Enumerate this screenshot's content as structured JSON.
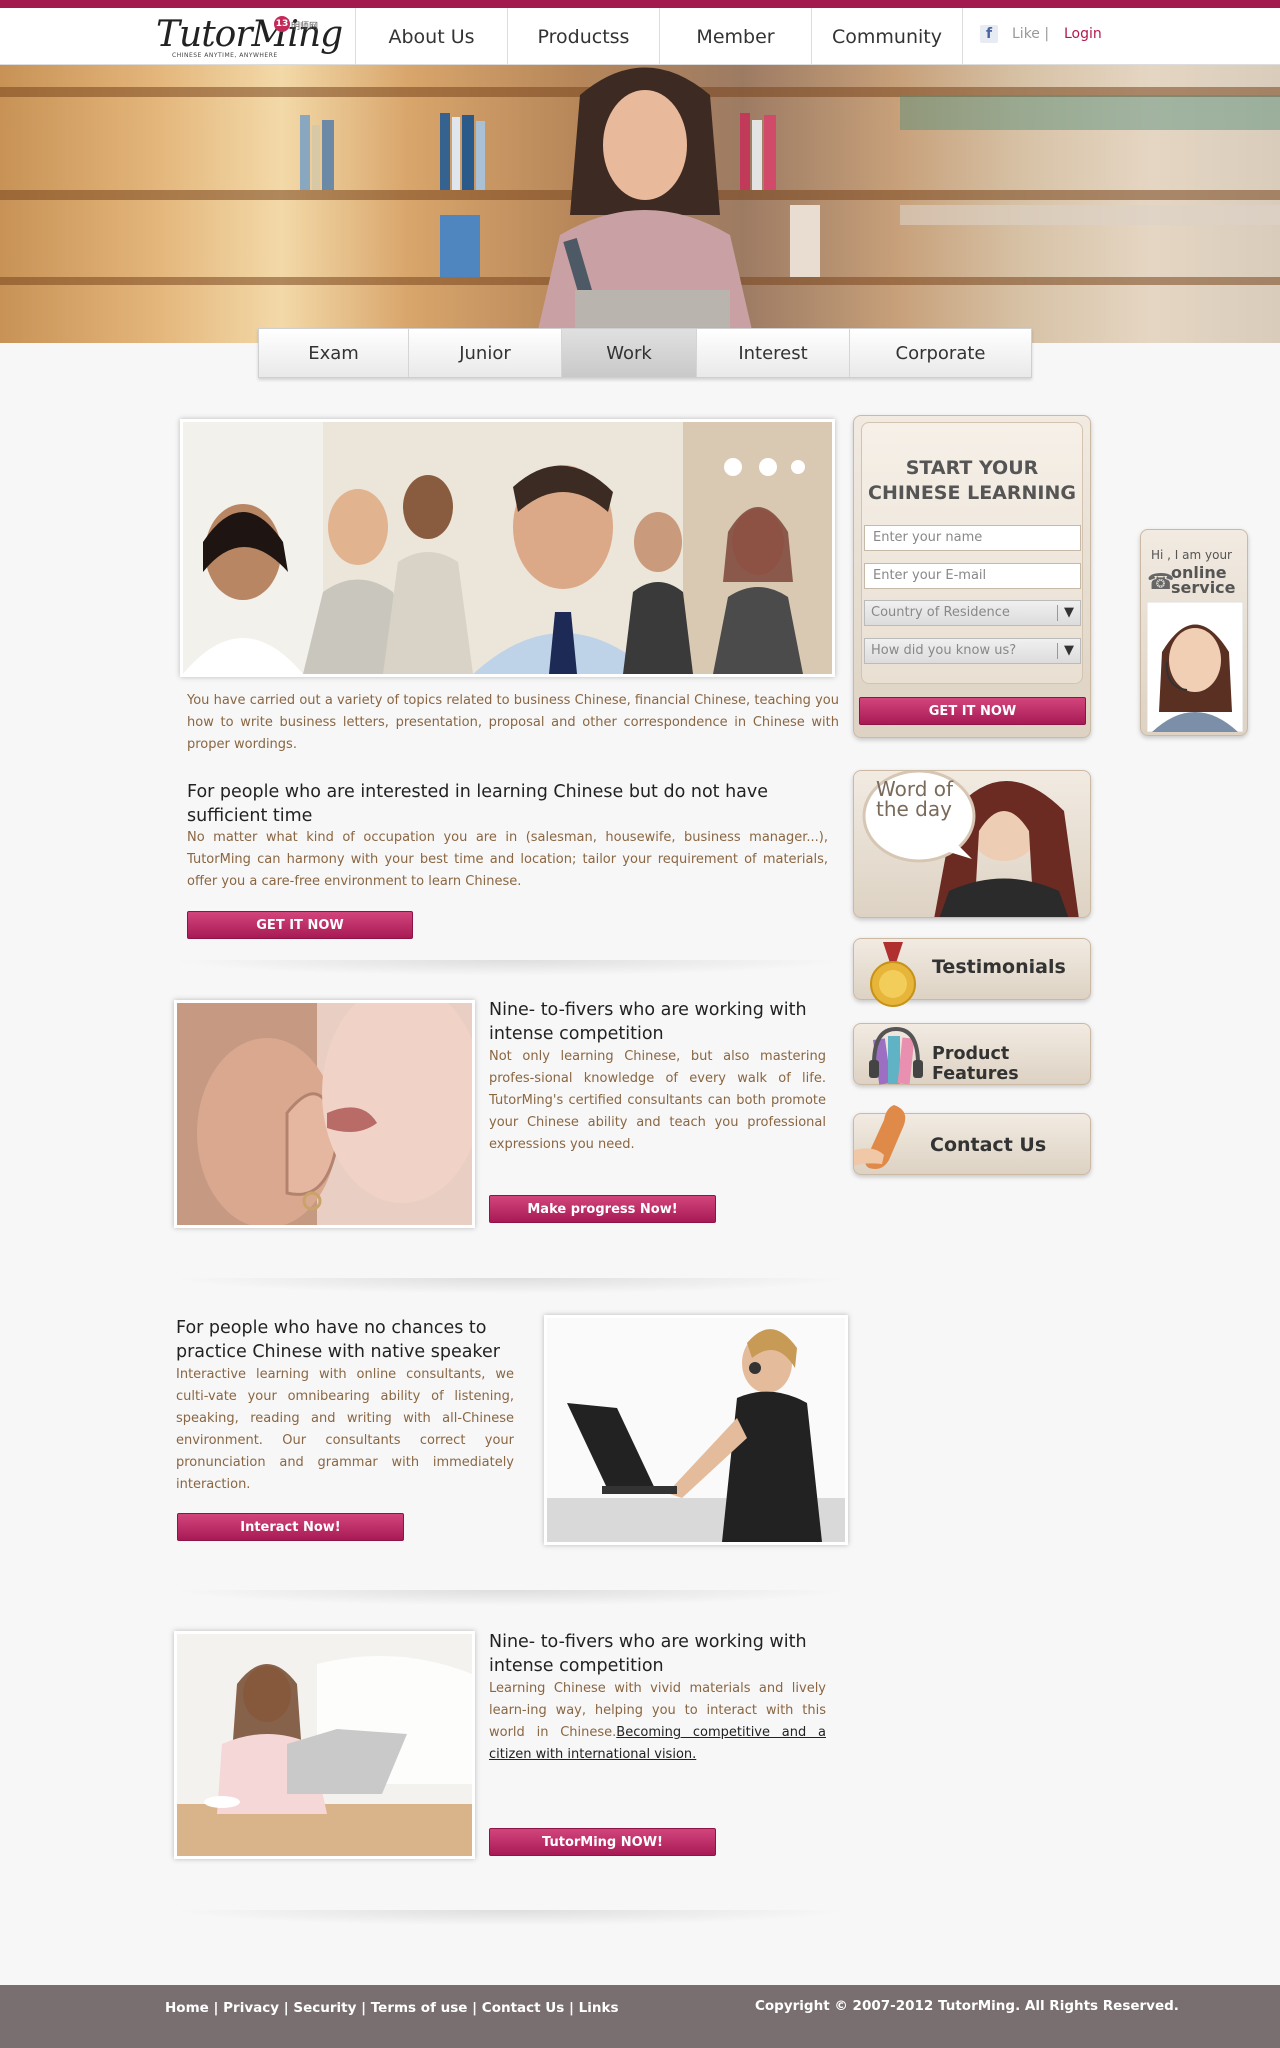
{
  "header": {
    "logo_text": "TutorMing",
    "logo_tagline": "CHINESE ANYTIME, ANYWHERE",
    "logo_badge": "13",
    "logo_badge_text": "明师网",
    "nav": [
      "About Us",
      "Productss",
      "Member",
      "Community"
    ],
    "like_label": "Like |",
    "login_label": "Login"
  },
  "subtabs": {
    "items": [
      "Exam",
      "Junior",
      "Work",
      "Interest",
      "Corporate"
    ],
    "active": "Work"
  },
  "section1": {
    "intro": "You have carried out a variety of topics related to business Chinese, financial Chinese, teaching you how to write business letters, presentation, proposal and other correspondence in Chinese with proper wordings.",
    "heading": "For people who are interested in learning Chinese but do not have sufficient time",
    "body": "No matter what kind of occupation you are in (salesman, housewife, business manager...), TutorMing can harmony with your best time and location; tailor your requirement of materials, offer you a care-free environment to learn Chinese.",
    "button": "GET IT NOW"
  },
  "section2": {
    "heading": "Nine- to-fivers who are working with intense competition",
    "body": "Not only learning Chinese, but also mastering profes-sional knowledge of every walk of life. TutorMing's certified consultants can both promote your Chinese ability and teach you professional expressions you need.",
    "button": "Make progress Now!"
  },
  "section3": {
    "heading": "For people who have no chances to practice Chinese with native speaker",
    "body": "Interactive learning with online consultants, we culti-vate your omnibearing ability of listening, speaking, reading and writing with all-Chinese environment. Our consultants correct your pronunciation and grammar with immediately interaction.",
    "button": "Interact Now!"
  },
  "section4": {
    "heading": "Nine- to-fivers who are working with intense competition",
    "body_plain": "Learning Chinese with vivid materials and lively learn-ing way, helping you to interact with this world in Chinese.",
    "body_link": "Becoming competitive and a citizen with international vision.",
    "button": "TutorMing NOW!"
  },
  "signup": {
    "title_line1": "START YOUR",
    "title_line2": "CHINESE LEARNING",
    "name_placeholder": "Enter your name",
    "email_placeholder": "Enter your E-mail",
    "country_placeholder": "Country of Residence",
    "source_placeholder": "How did you know us?",
    "button": "GET IT NOW"
  },
  "sidebar": {
    "word_of_day_line1": "Word of",
    "word_of_day_line2": "the day",
    "testimonials": "Testimonials",
    "product_features": "Product Features",
    "contact_us": "Contact Us"
  },
  "online_service": {
    "greeting": "Hi , I am your",
    "line1": "online",
    "line2": "service"
  },
  "footer": {
    "links": [
      "Home",
      "Privacy",
      "Security",
      "Terms of use",
      "Contact Us",
      "Links"
    ],
    "separator": " | ",
    "copyright": "Copyright © 2007-2012 TutorMing. All Rights Reserved."
  },
  "colors": {
    "brand": "#a31a4f",
    "button": "#c02c68",
    "body_text": "#8a6642",
    "footer": "#7a6f70"
  }
}
